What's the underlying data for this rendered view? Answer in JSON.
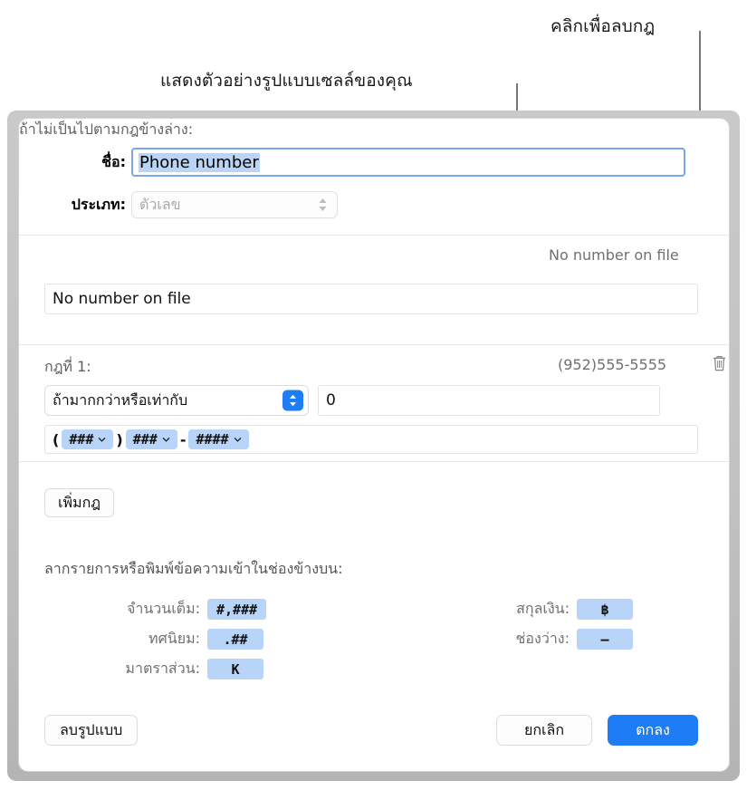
{
  "annotations": {
    "delete_rule": "คลิกเพื่อลบกฎ",
    "preview": "แสดงตัวอย่างรูปแบบเซลล์ของคุณ"
  },
  "dialog": {
    "name": {
      "label": "ชื่อ:",
      "value": "Phone number"
    },
    "type": {
      "label": "ประเภท:",
      "value": "ตัวเลข",
      "stepper_icon": "stepper-updown-icon"
    },
    "fallback": {
      "label": "ถ้าไม่เป็นไปตามกฎข้างล่าง:",
      "preview": "No number on file",
      "value": "No number on file"
    },
    "rule": {
      "label": "กฎที่ 1:",
      "preview": "(952)555-5555",
      "delete_icon": "trash-icon",
      "condition": "ถ้ามากกว่าหรือเท่ากับ",
      "condition_stepper_icon": "stepper-updown-icon",
      "condition_value": "0",
      "format": {
        "open_paren": "(",
        "close_paren": ")",
        "dash": "-",
        "tokens": [
          {
            "text": "###",
            "chevron": "chevron-down-icon"
          },
          {
            "text": "###",
            "chevron": "chevron-down-icon"
          },
          {
            "text": "####",
            "chevron": "chevron-down-icon"
          }
        ]
      }
    },
    "add_rule_label": "เพิ่มกฎ",
    "drag_hint": "ลากรายการหรือพิมพ์ข้อความเข้าในช่องข้างบน:",
    "palette": [
      {
        "label": "จำนวนเต็ม:",
        "token": "#,###"
      },
      {
        "label": "ทศนิยม:",
        "token": ".##"
      },
      {
        "label": "มาตราส่วน:",
        "token": "K"
      },
      {
        "label": "สกุลเงิน:",
        "token": "฿"
      },
      {
        "label": "ช่องว่าง:",
        "token": "–"
      }
    ],
    "buttons": {
      "delete_format": "ลบรูปแบบ",
      "cancel": "ยกเลิก",
      "ok": "ตกลง"
    }
  },
  "colors": {
    "accent": "#1e7df5",
    "token_chip": "#b8d4f8",
    "selection": "#b9d4f5",
    "leader": "#767676"
  }
}
